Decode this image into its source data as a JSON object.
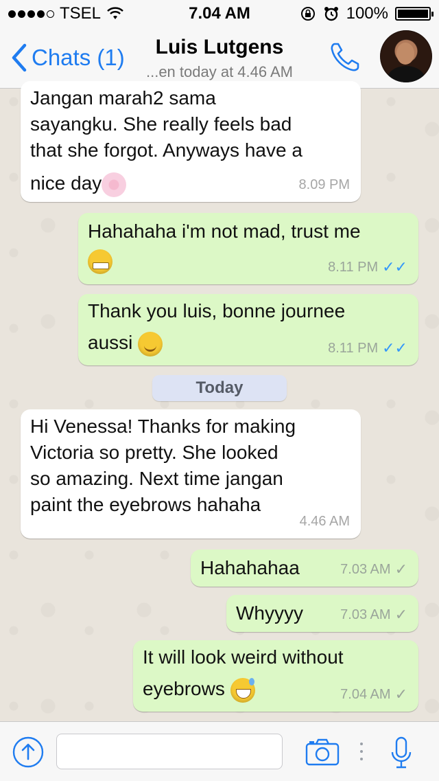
{
  "status_bar": {
    "carrier": "TSEL",
    "time": "7.04 AM",
    "battery": "100%"
  },
  "header": {
    "back_label": "Chats (1)",
    "contact_name": "Luis Lutgens",
    "last_seen": "...en today at 4.46 AM"
  },
  "messages": [
    {
      "direction": "in",
      "text_lines": [
        "Jangan marah2 sama",
        "sayangku. She really feels bad",
        "that she forgot. Anyways have a",
        "nice day"
      ],
      "time": "8.09 PM"
    },
    {
      "direction": "out",
      "text": "Hahahaha i'm not mad, trust me",
      "time": "8.11 PM",
      "status": "read"
    },
    {
      "direction": "out",
      "text_lines": [
        "Thank you luis, bonne journee",
        "aussi"
      ],
      "time": "8.11 PM",
      "status": "read"
    },
    {
      "direction": "in",
      "text_lines": [
        "Hi Venessa! Thanks for making",
        "Victoria so pretty. She looked",
        "so amazing. Next time jangan",
        "paint the eyebrows hahaha"
      ],
      "time": "4.46 AM"
    },
    {
      "direction": "out",
      "text": "Hahahahaa",
      "time": "7.03 AM",
      "status": "delivered"
    },
    {
      "direction": "out",
      "text": "Whyyyy",
      "time": "7.03 AM",
      "status": "delivered"
    },
    {
      "direction": "out",
      "text_lines": [
        "It will look weird without",
        "eyebrows"
      ],
      "time": "7.04 AM",
      "status": "delivered"
    }
  ],
  "day_separator": "Today",
  "composer": {
    "placeholder": ""
  },
  "colors": {
    "accent": "#1f7cf0",
    "outgoing_bubble": "#dcf8c6",
    "incoming_bubble": "#ffffff",
    "read_tick": "#3497f9"
  },
  "icons": [
    "signal-dots-icon",
    "wifi-icon",
    "lock-rotation-icon",
    "alarm-icon",
    "battery-icon",
    "chevron-left-icon",
    "phone-icon",
    "share-arrow-icon",
    "camera-icon",
    "microphone-icon"
  ]
}
